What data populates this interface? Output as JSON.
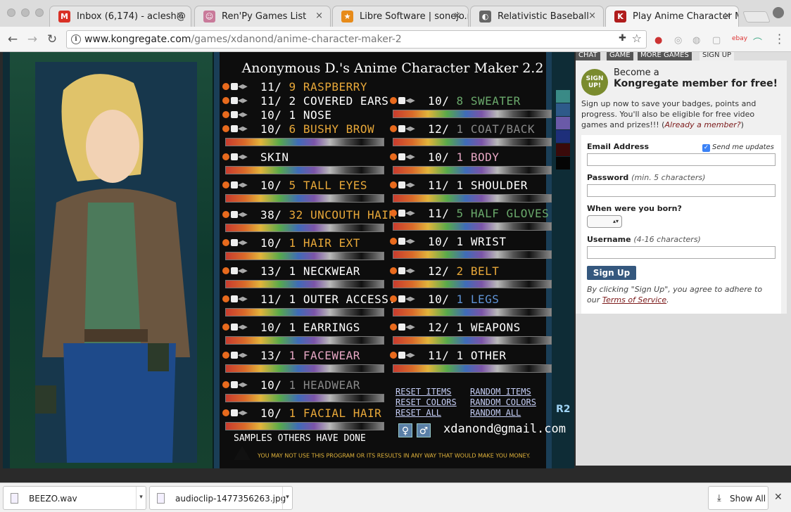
{
  "browser": {
    "tabs": [
      {
        "title": "Inbox (6,174) - aclesh@",
        "icon": "gmail-icon",
        "icon_text": "M",
        "color": "#d93025"
      },
      {
        "title": "Ren'Py Games List",
        "icon": "renpy-icon",
        "icon_text": "☺",
        "color": "#c97a9a"
      },
      {
        "title": "Libre Software | sonejo.n",
        "icon": "sonejo-icon",
        "icon_text": "★",
        "color": "#e78b1a"
      },
      {
        "title": "Relativistic Baseball",
        "icon": "baseball-icon",
        "icon_text": "◐",
        "color": "#666666"
      },
      {
        "title": "Play Anime Character Ma",
        "icon": "kongregate-icon",
        "icon_text": "K",
        "color": "#b01c1c"
      }
    ],
    "url_domain": "www.kongregate.com",
    "url_path": "/games/xdanond/anime-character-maker-2"
  },
  "game": {
    "title": "Anonymous D.'s Anime Character Maker 2.2",
    "left_rows": [
      {
        "count": "11/",
        "num": "9",
        "name": "RASPBERRY",
        "color": "c"
      },
      {
        "count": "11/",
        "num": "2",
        "name": "COVERED EARS",
        "color": "w"
      },
      {
        "count": "10/",
        "num": "1",
        "name": "NOSE",
        "color": "w"
      },
      {
        "count": "10/",
        "num": "6",
        "name": "BUSHY BROW",
        "color": "c"
      },
      {
        "count": "",
        "num": "",
        "name": "SKIN",
        "color": "w"
      },
      {
        "count": "10/",
        "num": "5",
        "name": "TALL EYES",
        "color": "c"
      },
      {
        "count": "38/",
        "num": "32",
        "name": "UNCOUTH HAIR",
        "color": "c"
      },
      {
        "count": "10/",
        "num": "1",
        "name": "HAIR EXT",
        "color": "c"
      },
      {
        "count": "13/",
        "num": "1",
        "name": "NECKWEAR",
        "color": "w"
      },
      {
        "count": "11/",
        "num": "1",
        "name": "OUTER ACCESS.",
        "color": "w"
      },
      {
        "count": "10/",
        "num": "1",
        "name": "EARRINGS",
        "color": "w"
      },
      {
        "count": "13/",
        "num": "1",
        "name": "FACEWEAR",
        "color": "p"
      },
      {
        "count": "10/",
        "num": "1",
        "name": "HEADWEAR",
        "color": "gr"
      },
      {
        "count": "10/",
        "num": "1",
        "name": "FACIAL HAIR",
        "color": "c"
      }
    ],
    "right_rows": [
      {
        "count": "10/",
        "num": "8",
        "name": "SWEATER",
        "color": "g"
      },
      {
        "count": "12/",
        "num": "1",
        "name": "COAT/BACK",
        "color": "gr"
      },
      {
        "count": "10/",
        "num": "1",
        "name": "BODY",
        "color": "p"
      },
      {
        "count": "11/",
        "num": "1",
        "name": "SHOULDER",
        "color": "w"
      },
      {
        "count": "11/",
        "num": "5",
        "name": "HALF GLOVES",
        "color": "g"
      },
      {
        "count": "10/",
        "num": "1",
        "name": "WRIST",
        "color": "w"
      },
      {
        "count": "12/",
        "num": "2",
        "name": "BELT",
        "color": "c"
      },
      {
        "count": "10/",
        "num": "1",
        "name": "LEGS",
        "color": "b"
      },
      {
        "count": "12/",
        "num": "1",
        "name": "WEAPONS",
        "color": "w"
      },
      {
        "count": "11/",
        "num": "1",
        "name": "OTHER",
        "color": "w"
      }
    ],
    "reset_items": "RESET ITEMS",
    "reset_colors": "RESET COLORS",
    "reset_all": "RESET ALL",
    "random_items": "RANDOM ITEMS",
    "random_colors": "RANDOM COLORS",
    "random_all": "RANDOM ALL",
    "email": "xdanond@gmail.com",
    "samples": "SAMPLES OTHERS HAVE DONE",
    "warning": "YOU MAY NOT USE THIS PROGRAM OR ITS RESULTS IN ANY WAY THAT WOULD MAKE YOU MONEY.",
    "r2": "R2",
    "swatches": [
      "#3a8a86",
      "#2e5a8a",
      "#6a5aa8",
      "#1e2f7a",
      "#3a0a0a",
      "#050505"
    ]
  },
  "side": {
    "tabs": [
      "CHAT",
      "GAME",
      "MORE GAMES",
      "SIGN UP"
    ],
    "seal": "SIGN UP!",
    "become_line1": "Become a",
    "become_line2": "Kongregate member for free!",
    "desc": "Sign up now to save your badges, points and progress. You'll also be eligible for free video games and prizes!!! (",
    "already": "Already a member?",
    "desc_end": ")",
    "email_label": "Email Address",
    "send_updates": "Send me updates",
    "password_label": "Password",
    "password_hint": "(min. 5 characters)",
    "born_label": "When were you born?",
    "username_label": "Username",
    "username_hint": "(4-16 characters)",
    "signup_button": "Sign Up",
    "terms_pre": "By clicking \"Sign Up\", you agree to adhere to our ",
    "terms_link": "Terms of Service",
    "terms_post": "."
  },
  "downloads": {
    "items": [
      "BEEZO.wav",
      "audioclip-1477356263.jpg"
    ],
    "show_all": "Show All"
  }
}
